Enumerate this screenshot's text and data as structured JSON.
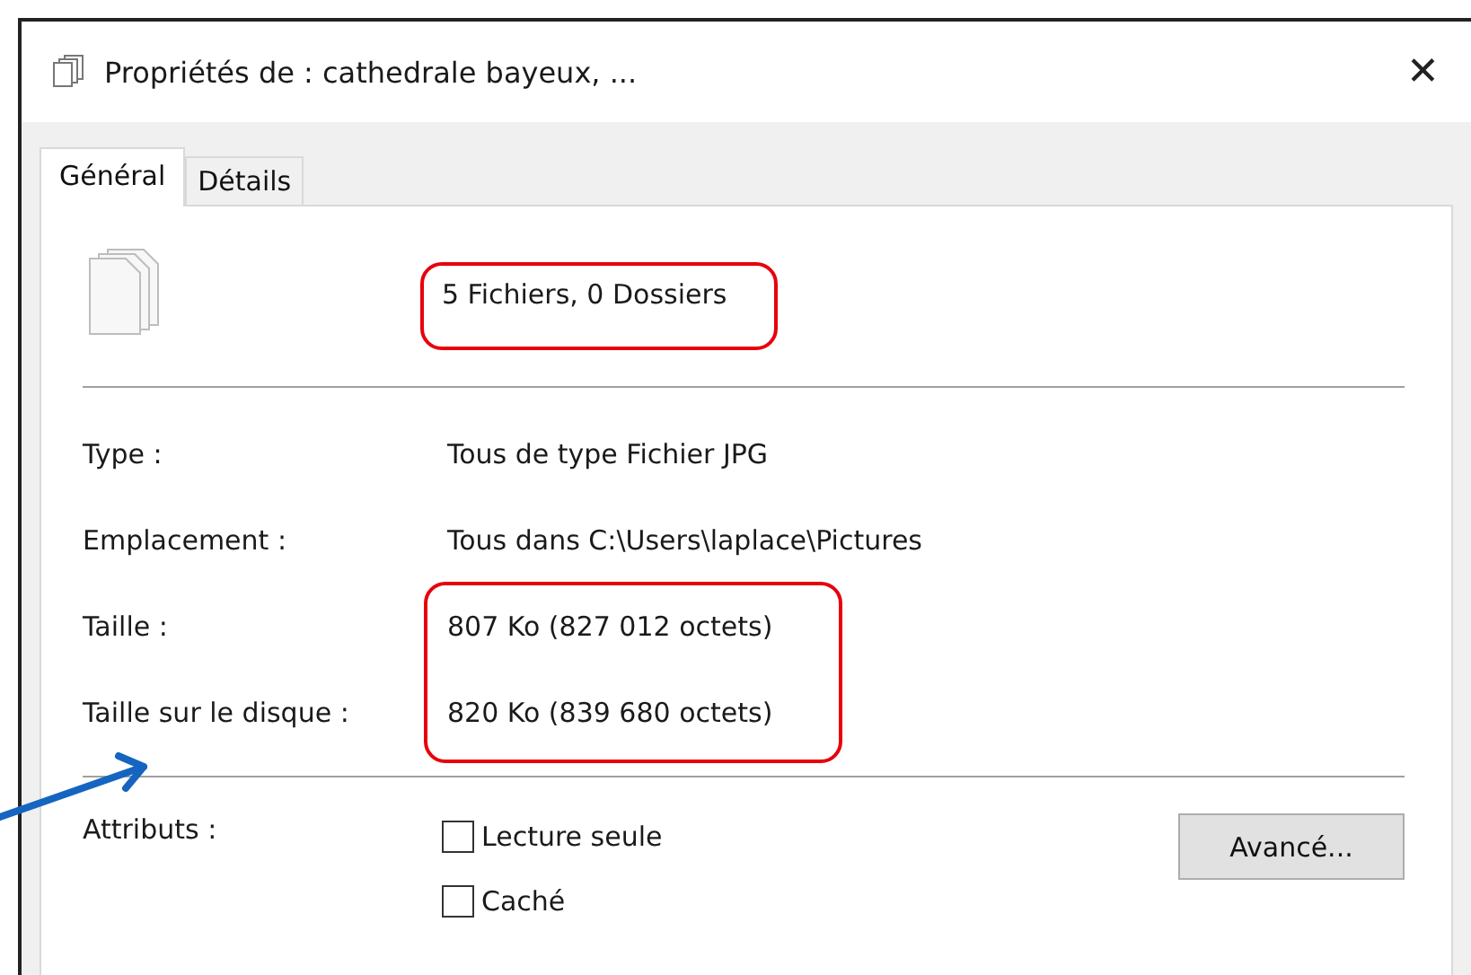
{
  "window": {
    "title": "Propriétés de : cathedrale bayeux, ...",
    "close": "✕"
  },
  "tabs": [
    {
      "label": "Général",
      "selected": true
    },
    {
      "label": "Détails",
      "selected": false
    }
  ],
  "summary": "5 Fichiers, 0 Dossiers",
  "properties": [
    {
      "label": "Type :",
      "value": "Tous de type Fichier JPG"
    },
    {
      "label": "Emplacement :",
      "value": "Tous dans C:\\Users\\laplace\\Pictures"
    },
    {
      "label": "Taille :",
      "value": "807 Ko (827 012 octets)"
    },
    {
      "label": "Taille sur le disque :",
      "value": "820 Ko (839 680 octets)"
    }
  ],
  "attributes": {
    "label": "Attributs :",
    "options": [
      {
        "label": "Lecture seule",
        "checked": false
      },
      {
        "label": "Caché",
        "checked": false
      }
    ],
    "button": "Avancé..."
  }
}
